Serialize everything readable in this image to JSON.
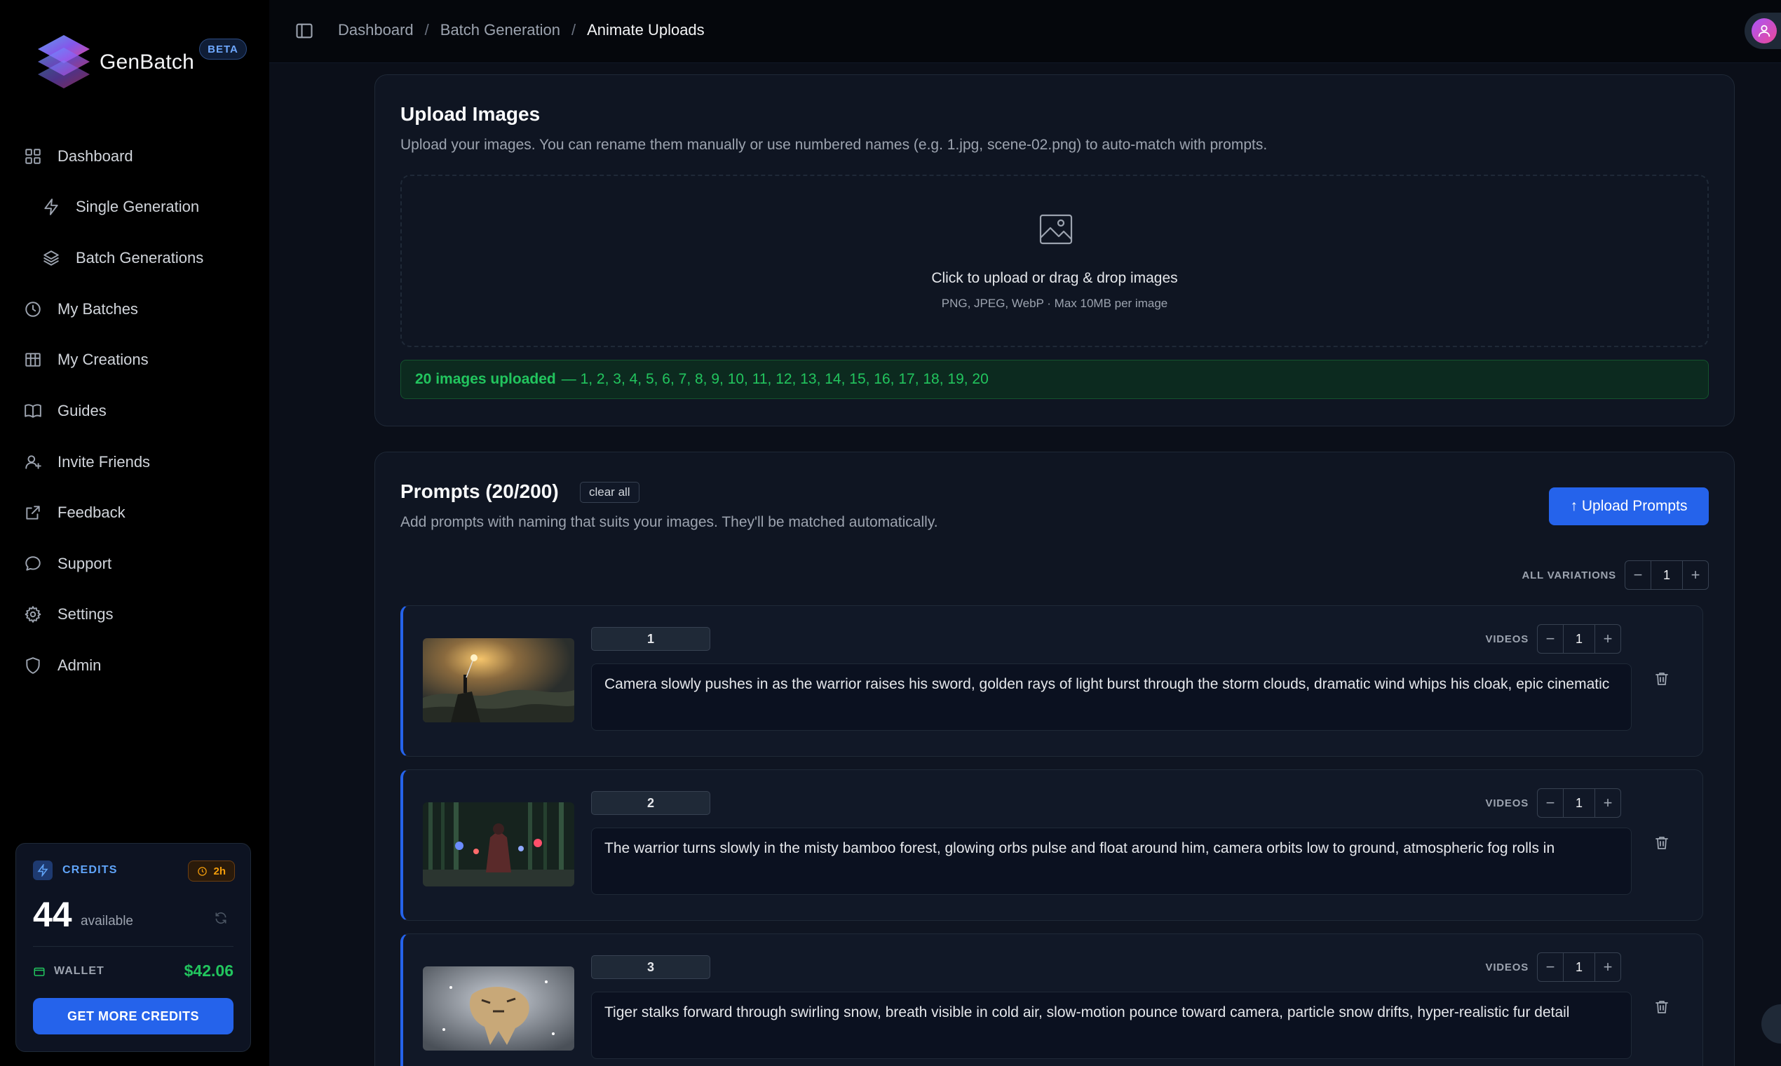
{
  "app": {
    "name": "GenBatch",
    "badge": "BETA"
  },
  "sidebar": {
    "items": [
      {
        "label": "Dashboard",
        "icon": "grid-icon"
      },
      {
        "label": "Single Generation",
        "icon": "bolt-icon"
      },
      {
        "label": "Batch Generations",
        "icon": "layers-icon"
      },
      {
        "label": "My Batches",
        "icon": "clock-icon"
      },
      {
        "label": "My Creations",
        "icon": "film-icon"
      },
      {
        "label": "Guides",
        "icon": "book-icon"
      },
      {
        "label": "Invite Friends",
        "icon": "user-plus-icon"
      },
      {
        "label": "Feedback",
        "icon": "external-link-icon"
      },
      {
        "label": "Support",
        "icon": "chat-bubble-icon"
      },
      {
        "label": "Settings",
        "icon": "gear-icon"
      },
      {
        "label": "Admin",
        "icon": "shield-icon"
      }
    ]
  },
  "credits": {
    "label": "CREDITS",
    "time_badge": "2h",
    "amount": "44",
    "available": "available",
    "wallet_label": "WALLET",
    "wallet_value": "$42.06",
    "cta": "GET MORE CREDITS"
  },
  "header": {
    "breadcrumb": [
      "Dashboard",
      "Batch Generation",
      "Animate Uploads"
    ],
    "separator": "/"
  },
  "upload": {
    "title": "Upload Images",
    "description": "Upload your images. You can rename them manually or use numbered names (e.g. 1.jpg, scene-02.png) to auto-match with prompts.",
    "dropzone_title": "Click to upload or drag & drop images",
    "dropzone_sub": "PNG, JPEG, WebP · Max 10MB per image",
    "uploaded_strong": "20 images uploaded",
    "uploaded_list": "— 1, 2, 3, 4, 5, 6, 7, 8, 9, 10, 11, 12, 13, 14, 15, 16, 17, 18, 19, 20"
  },
  "prompts": {
    "title": "Prompts (20/200)",
    "clear_all": "clear all",
    "description": "Add prompts with naming that suits your images. They'll be matched automatically.",
    "upload_button": "↑ Upload Prompts",
    "all_variations_label": "ALL VARIATIONS",
    "all_variations_value": "1",
    "minus": "−",
    "plus": "+",
    "rows": [
      {
        "name": "1",
        "videos_label": "VIDEOS",
        "videos": "1",
        "text": "Camera slowly pushes in as the warrior raises his sword, golden rays of light burst through the storm clouds, dramatic wind whips his cloak, epic cinematic"
      },
      {
        "name": "2",
        "videos_label": "VIDEOS",
        "videos": "1",
        "text": "The warrior turns slowly in the misty bamboo forest, glowing orbs pulse and float around him, camera orbits low to ground, atmospheric fog rolls in"
      },
      {
        "name": "3",
        "videos_label": "VIDEOS",
        "videos": "1",
        "text": "Tiger stalks forward through swirling snow, breath visible in cold air, slow-motion pounce toward camera, particle snow drifts, hyper-realistic fur detail"
      }
    ]
  },
  "colors": {
    "accent": "#2563eb",
    "success": "#22c55e",
    "warning": "#f59e0b",
    "background": "#0b0f19"
  }
}
